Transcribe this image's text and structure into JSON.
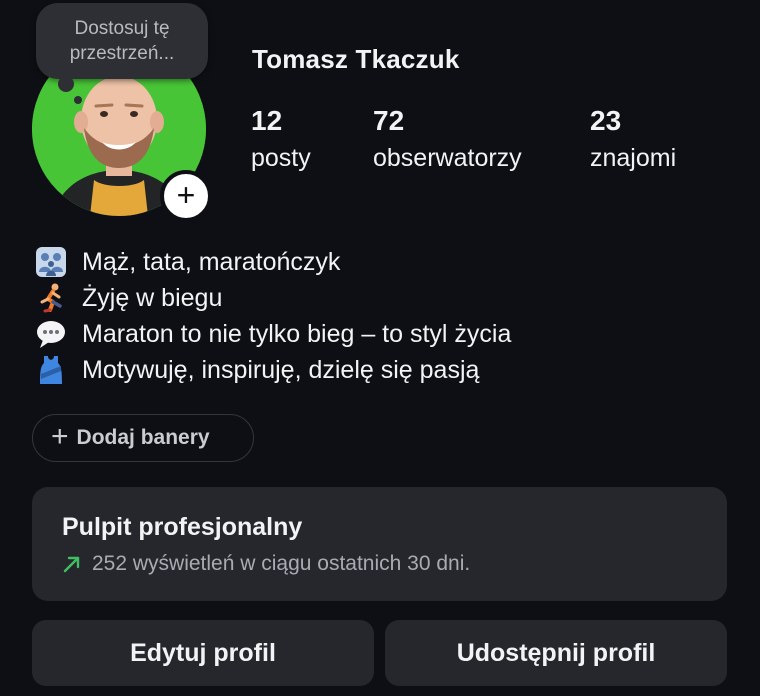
{
  "profile": {
    "name": "Tomasz Tkaczuk",
    "note_text": "Dostosuj tę przestrzeń...",
    "add_story_symbol": "+",
    "stats": [
      {
        "value": "12",
        "label": "posty"
      },
      {
        "value": "72",
        "label": "obserwatorzy"
      },
      {
        "value": "23",
        "label": "znajomi"
      }
    ]
  },
  "bio": [
    {
      "icon": "family-icon",
      "text": "Mąż, tata, maratończyk"
    },
    {
      "icon": "runner-icon",
      "text": "Żyję w biegu"
    },
    {
      "icon": "speech-bubble-icon",
      "text": "Maraton to nie tylko bieg – to styl życia"
    },
    {
      "icon": "running-shirt-icon",
      "text": "Motywuję, inspiruję, dzielę się pasją"
    }
  ],
  "banners": {
    "plus_symbol": "+",
    "label": "Dodaj banery"
  },
  "dashboard": {
    "title": "Pulpit profesjonalny",
    "subtitle": "252 wyświetleń w ciągu ostatnich 30 dni.",
    "accent_color": "#3fbf62"
  },
  "actions": {
    "edit_label": "Edytuj profil",
    "share_label": "Udostępnij profil"
  },
  "colors": {
    "background": "#0d0f14",
    "card": "#25272d",
    "avatar_bg": "#48c437"
  }
}
